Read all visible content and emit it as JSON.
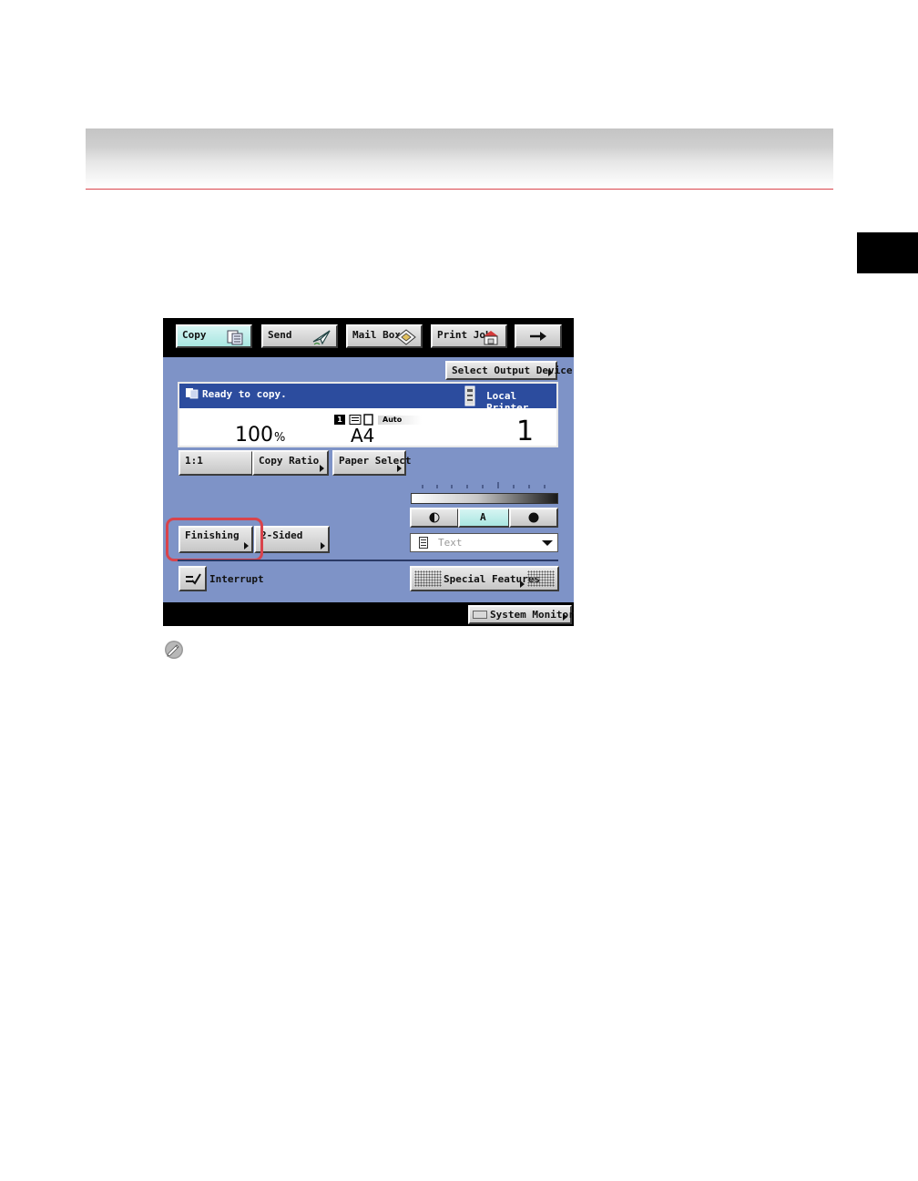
{
  "tabs": [
    {
      "label": "Copy",
      "icon": "copy-icon",
      "active": true
    },
    {
      "label": "Send",
      "icon": "send-icon",
      "active": false
    },
    {
      "label": "Mail Box",
      "icon": "mail-box-icon",
      "active": false
    },
    {
      "label": "Print Job",
      "icon": "print-job-icon",
      "active": false
    },
    {
      "label": "",
      "icon": "arrow-right-icon",
      "active": false
    }
  ],
  "output_device_button": "Select Output Device",
  "status": {
    "message": "Ready to copy.",
    "printer": "Local Printer",
    "ratio": "100",
    "ratio_unit": "%",
    "paper_badge": "1",
    "paper_auto": "Auto",
    "paper_size": "A4",
    "copies": "1"
  },
  "buttons": {
    "one_to_one": "1:1",
    "copy_ratio": "Copy Ratio",
    "paper_select": "Paper Select",
    "finishing": "Finishing",
    "two_sided": "2-Sided",
    "interrupt": "Interrupt",
    "special_features": "Special Features",
    "system_monitor": "System Monitor"
  },
  "density": {
    "auto_label": "A",
    "level": 0.5
  },
  "image_quality": {
    "selected": "Text"
  },
  "colors": {
    "panel": "#7e93c7",
    "status_bar": "#2c4c9e",
    "active_tab": "#a9e6e1",
    "highlight": "#d9434b"
  }
}
